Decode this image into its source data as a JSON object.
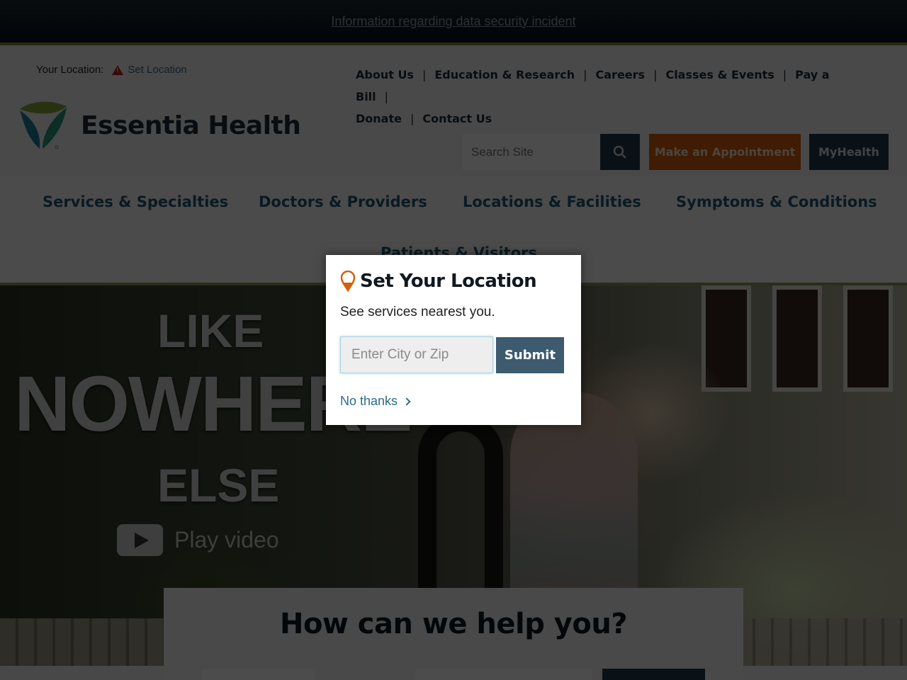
{
  "alert_bar": {
    "link": "Information regarding data security incident"
  },
  "header": {
    "location_label": "Your Location:",
    "set_location_link": "Set Location",
    "brand_name": "Essentia Health",
    "utility_nav": [
      "About Us",
      "Education & Research",
      "Careers",
      "Classes & Events",
      "Pay a Bill",
      "Donate",
      "Contact Us"
    ],
    "search_placeholder": "Search Site",
    "appointment_button": "Make an Appointment",
    "myhealth_button": "MyHealth"
  },
  "main_nav": [
    "Services & Specialties",
    "Doctors & Providers",
    "Locations & Facilities",
    "Symptoms & Conditions",
    "Patients & Visitors"
  ],
  "hero": {
    "line1": "LIKE",
    "line2": "NOWHERE",
    "line3": "ELSE",
    "play_label": "Play video"
  },
  "help_panel": {
    "heading": "How can we help you?"
  },
  "modal": {
    "title": "Set Your Location",
    "subtitle": "See services nearest you.",
    "input_placeholder": "Enter City or Zip",
    "input_value": "",
    "submit": "Submit",
    "dismiss": "No thanks"
  },
  "colors": {
    "accent_orange": "#d4600a",
    "navy": "#243a4a",
    "nav_blue": "#245775",
    "rule_green": "#8a9a4a"
  }
}
